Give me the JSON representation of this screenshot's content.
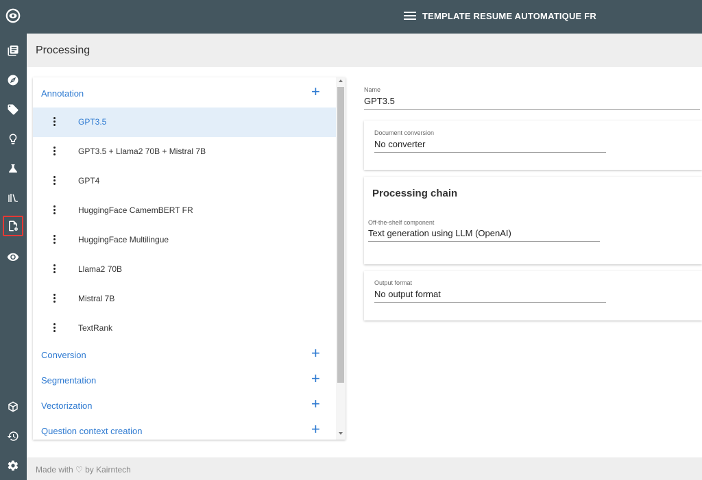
{
  "topbar": {
    "title": "TEMPLATE RESUME AUTOMATIQUE FR"
  },
  "page": {
    "title": "Processing"
  },
  "sidebar": {
    "icons": [
      "eye-logo-icon",
      "documents-icon",
      "compass-icon",
      "tag-icon",
      "lightbulb-icon",
      "flask-icon",
      "books-icon",
      "processing-icon",
      "eye-settings-icon",
      "cube-icon",
      "history-icon",
      "gear-icon"
    ],
    "active": "processing-icon"
  },
  "list": {
    "sections": [
      {
        "label": "Annotation",
        "add_label": "+"
      },
      {
        "label": "Conversion",
        "add_label": "+"
      },
      {
        "label": "Segmentation",
        "add_label": "+"
      },
      {
        "label": "Vectorization",
        "add_label": "+"
      },
      {
        "label": "Question context creation",
        "add_label": "+"
      }
    ],
    "annotation_items": [
      "GPT3.5",
      "GPT3.5 + Llama2 70B + Mistral 7B",
      "GPT4",
      "HuggingFace CamemBERT FR",
      "HuggingFace Multilingue",
      "Llama2 70B",
      "Mistral 7B",
      "TextRank"
    ],
    "selected": "GPT3.5"
  },
  "form": {
    "name": {
      "label": "Name",
      "value": "GPT3.5"
    },
    "document_conversion": {
      "label": "Document conversion",
      "value": "No converter"
    },
    "processing_chain": {
      "title": "Processing chain",
      "component_label": "Off-the-shelf component",
      "component_value": "Text generation using LLM (OpenAI)"
    },
    "output_format": {
      "label": "Output format",
      "value": "No output format"
    }
  },
  "footer": {
    "text": "Made with ♡ by Kairntech"
  },
  "colors": {
    "sidebar": "#44565f",
    "accent": "#2e7ad1",
    "selected_bg": "#e3eef9",
    "active_border": "#e53935"
  }
}
